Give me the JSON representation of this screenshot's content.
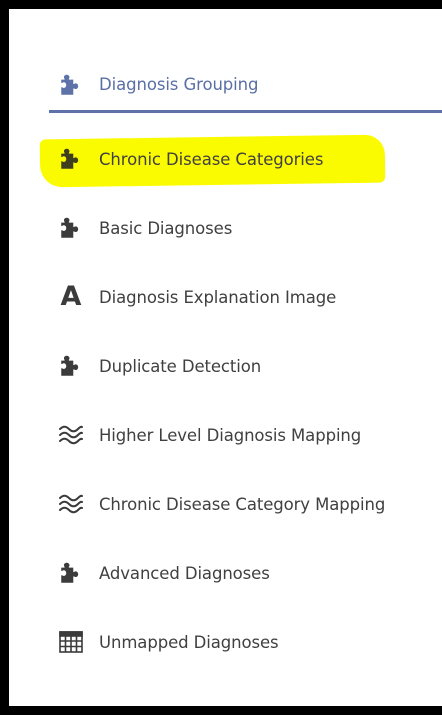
{
  "header": {
    "label": "Diagnosis Grouping",
    "icon": "puzzle-piece-icon",
    "accent_color": "#5c72a8"
  },
  "items": [
    {
      "label": "Chronic Disease Categories",
      "icon": "puzzle-piece-icon",
      "highlighted": true,
      "highlight_color": "#fbfb00"
    },
    {
      "label": "Basic Diagnoses",
      "icon": "puzzle-piece-icon"
    },
    {
      "label": "Diagnosis Explanation Image",
      "icon": "letter-a-icon"
    },
    {
      "label": "Duplicate Detection",
      "icon": "puzzle-piece-icon"
    },
    {
      "label": "Higher Level Diagnosis Mapping",
      "icon": "waves-icon"
    },
    {
      "label": "Chronic Disease Category Mapping",
      "icon": "waves-icon"
    },
    {
      "label": "Advanced Diagnoses",
      "icon": "puzzle-piece-icon"
    },
    {
      "label": "Unmapped Diagnoses",
      "icon": "table-icon"
    }
  ],
  "letter_icon_glyph": "A"
}
